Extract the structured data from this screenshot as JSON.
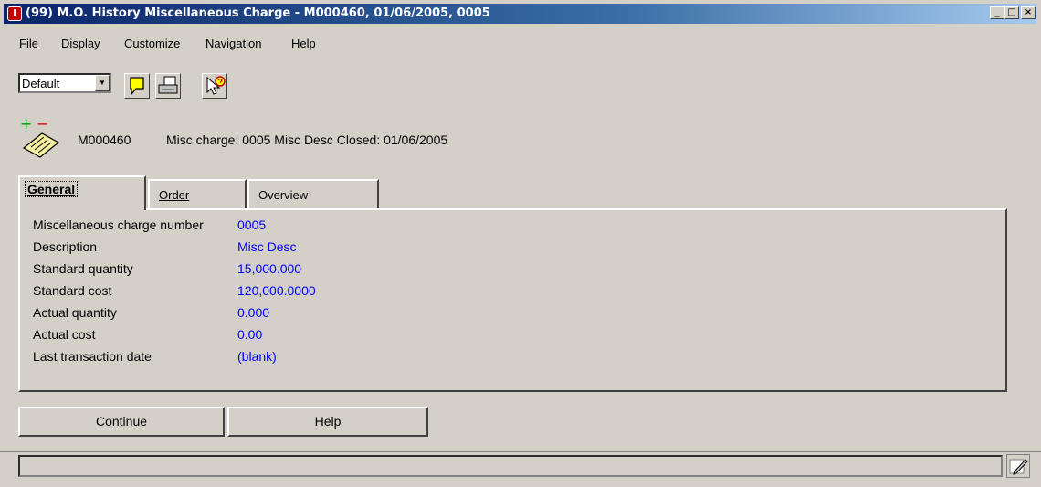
{
  "window": {
    "title": "(99) M.O. History Miscellaneous Charge - M000460, 01/06/2005, 0005",
    "app_icon": "I",
    "controls": {
      "minimize": "_",
      "maximize": "□",
      "close": "×"
    }
  },
  "menu": {
    "items": [
      "File",
      "Display",
      "Customize",
      "Navigation",
      "Help"
    ]
  },
  "toolbar": {
    "view_select": {
      "value": "Default"
    },
    "buttons": [
      {
        "icon": "note-icon"
      },
      {
        "icon": "print-icon"
      },
      {
        "icon": "help-pointer-icon"
      }
    ]
  },
  "header": {
    "order": "M000460",
    "summary": "Misc charge: 0005  Misc Desc  Closed: 01/06/2005",
    "icon": "document-plus-minus-icon"
  },
  "tabs": [
    {
      "label": "General",
      "active": true
    },
    {
      "label": "Order",
      "active": false
    },
    {
      "label": "Overview",
      "active": false
    }
  ],
  "fields": [
    {
      "label": "Miscellaneous charge number",
      "value": "0005"
    },
    {
      "label": "Description",
      "value": "Misc Desc"
    },
    {
      "label": "Standard quantity",
      "value": "15,000.000"
    },
    {
      "label": "Standard cost",
      "value": "120,000.0000"
    },
    {
      "label": "Actual quantity",
      "value": "0.000"
    },
    {
      "label": "Actual cost",
      "value": "0.00"
    },
    {
      "label": "Last transaction date",
      "value": "(blank)"
    }
  ],
  "actions": {
    "continue_label": "Continue",
    "help_label": "Help"
  },
  "status_bar": {
    "text": "",
    "icon": "edit-pencil-icon"
  },
  "colors": {
    "value_text": "#0000ff",
    "title_bar": "#0a246a",
    "window_bg": "#d4d0c8"
  }
}
